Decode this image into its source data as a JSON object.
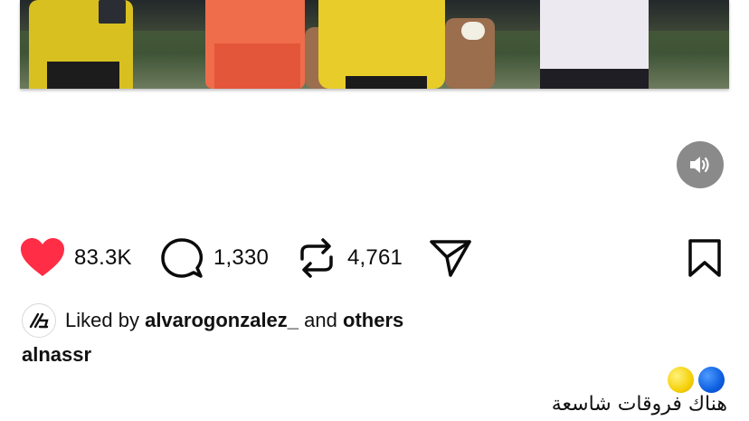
{
  "media": {
    "description_icon": "video-frame"
  },
  "controls": {
    "mute_icon": "speaker-icon"
  },
  "actions": {
    "likes": "83.3K",
    "comments": "1,330",
    "reposts": "4,761",
    "like_color": "#ff2d46"
  },
  "liked_by": {
    "prefix": "Liked by",
    "user": "alvarogonzalez_",
    "joiner": "and",
    "others": "others"
  },
  "post": {
    "username": "alnassr",
    "caption": "هناك فروقات شاسعة"
  }
}
